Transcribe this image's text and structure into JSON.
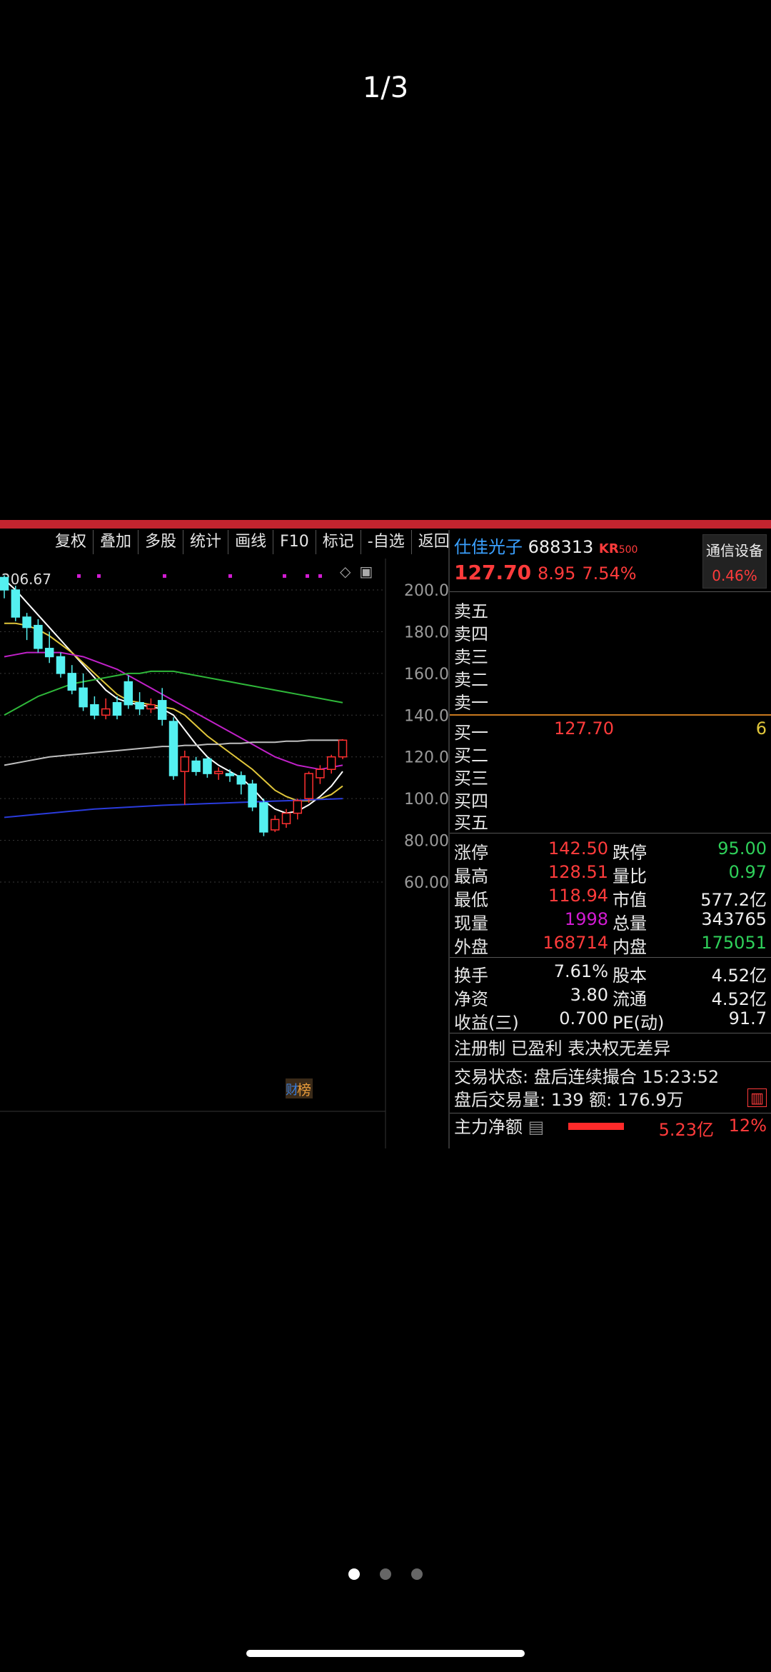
{
  "viewer": {
    "page_indicator": "1/3",
    "dots": 3,
    "active_dot": 0
  },
  "toolbar": {
    "items": [
      "复权",
      "叠加",
      "多股",
      "统计",
      "画线",
      "F10",
      "标记",
      "-自选",
      "返回"
    ]
  },
  "chart": {
    "high_label": "206.67",
    "y_ticks": [
      "200.0",
      "180.0",
      "160.0",
      "140.0",
      "120.0",
      "100.0",
      "80.00",
      "60.00"
    ],
    "badge_text": "榜",
    "badge_prefix": "财"
  },
  "chart_data": {
    "type": "candlestick",
    "ylim": [
      60,
      210
    ],
    "candles": [
      [
        206,
        200,
        207,
        196
      ],
      [
        200,
        187,
        202,
        185
      ],
      [
        187,
        182,
        189,
        176
      ],
      [
        183,
        172,
        186,
        170
      ],
      [
        172,
        168,
        180,
        165
      ],
      [
        168,
        160,
        170,
        158
      ],
      [
        160,
        152,
        164,
        150
      ],
      [
        153,
        144,
        160,
        142
      ],
      [
        145,
        140,
        149,
        138
      ],
      [
        140,
        143,
        148,
        138
      ],
      [
        146,
        140,
        149,
        138
      ],
      [
        156,
        145,
        159,
        143
      ],
      [
        146,
        143,
        151,
        140
      ],
      [
        143,
        145,
        148,
        141
      ],
      [
        147,
        138,
        153,
        135
      ],
      [
        137,
        111,
        139,
        109
      ],
      [
        113,
        120,
        123,
        97
      ],
      [
        118,
        113,
        120,
        111
      ],
      [
        119,
        112,
        120,
        110
      ],
      [
        112,
        113,
        115,
        109
      ],
      [
        112,
        111,
        114,
        108
      ],
      [
        111,
        107,
        113,
        102
      ],
      [
        107,
        96,
        109,
        94
      ],
      [
        98,
        84,
        100,
        82
      ],
      [
        85,
        90,
        92,
        84
      ],
      [
        88,
        93,
        95,
        86
      ],
      [
        93,
        99,
        100,
        90
      ],
      [
        100,
        112,
        113,
        98
      ],
      [
        110,
        114,
        116,
        107
      ],
      [
        114,
        120,
        121,
        112
      ],
      [
        120,
        128,
        128.5,
        118.9
      ]
    ],
    "ma_series": [
      {
        "color": "#ffffff",
        "values": [
          205,
          200,
          194,
          188,
          182,
          176,
          170,
          164,
          158,
          152,
          148,
          146,
          145,
          144,
          143,
          140,
          133,
          126,
          120,
          116,
          113,
          110,
          105,
          99,
          95,
          93,
          94,
          97,
          101,
          106,
          113
        ]
      },
      {
        "color": "#e0c63b",
        "values": [
          184,
          184,
          183,
          181,
          178,
          174,
          170,
          165,
          160,
          155,
          150,
          147,
          146,
          145,
          144,
          143,
          140,
          135,
          130,
          126,
          122,
          118,
          114,
          109,
          104,
          101,
          99,
          99,
          100,
          102,
          106
        ]
      },
      {
        "color": "#c021c8",
        "values": [
          168,
          169,
          170,
          170,
          170,
          170,
          169,
          168,
          166,
          164,
          162,
          159,
          156,
          153,
          150,
          147,
          144,
          141,
          138,
          135,
          132,
          129,
          126,
          123,
          120,
          118,
          116,
          115,
          114,
          115,
          116
        ]
      },
      {
        "color": "#2fb83a",
        "values": [
          140,
          143,
          146,
          149,
          151,
          153,
          155,
          156,
          157,
          158,
          159,
          160,
          160,
          161,
          161,
          161,
          160,
          159,
          158,
          157,
          156,
          155,
          154,
          153,
          152,
          151,
          150,
          149,
          148,
          147,
          146
        ]
      },
      {
        "color": "#bfbfbf",
        "values": [
          116,
          117,
          118,
          119,
          120,
          120.5,
          121,
          121.5,
          122,
          122.5,
          123,
          123.5,
          124,
          124.5,
          125,
          125,
          125.5,
          125.5,
          126,
          126,
          126.5,
          126.5,
          127,
          127,
          127,
          127.5,
          127.5,
          128,
          128,
          128,
          128
        ]
      },
      {
        "color": "#2a3bdc",
        "values": [
          91,
          91.5,
          92,
          92.5,
          93,
          93.5,
          94,
          94.5,
          95,
          95.3,
          95.6,
          95.9,
          96.2,
          96.5,
          96.8,
          97,
          97.2,
          97.4,
          97.6,
          97.8,
          98,
          98.2,
          98.4,
          98.6,
          98.8,
          99,
          99.2,
          99.4,
          99.6,
          99.8,
          100
        ]
      }
    ]
  },
  "stock": {
    "name": "仕佳光子",
    "code": "688313",
    "tag1": "KR",
    "tag2": "500",
    "price": "127.70",
    "change": "8.95",
    "pct": "7.54%",
    "industry": "通信设备",
    "industry_pct": "0.46%"
  },
  "orderbook": {
    "asks": [
      "卖五",
      "卖四",
      "卖三",
      "卖二",
      "卖一"
    ],
    "bids": [
      {
        "label": "买一",
        "price": "127.70",
        "vol": "6"
      },
      {
        "label": "买二",
        "price": "",
        "vol": ""
      },
      {
        "label": "买三",
        "price": "",
        "vol": ""
      },
      {
        "label": "买四",
        "price": "",
        "vol": ""
      },
      {
        "label": "买五",
        "price": "",
        "vol": ""
      }
    ]
  },
  "stats": {
    "limit_up_label": "涨停",
    "limit_up": "142.50",
    "limit_down_label": "跌停",
    "limit_down": "95.00",
    "high_label": "最高",
    "high": "128.51",
    "vol_ratio_label": "量比",
    "vol_ratio": "0.97",
    "low_label": "最低",
    "low": "118.94",
    "mcap_label": "市值",
    "mcap": "577.2亿",
    "cur_vol_label": "现量",
    "cur_vol": "1998",
    "total_vol_label": "总量",
    "total_vol": "343765",
    "outer_label": "外盘",
    "outer": "168714",
    "inner_label": "内盘",
    "inner": "175051",
    "turnover_label": "换手",
    "turnover": "7.61%",
    "shares_label": "股本",
    "shares": "4.52亿",
    "nav_label": "净资",
    "nav": "3.80",
    "float_label": "流通",
    "float": "4.52亿",
    "eps_label": "收益(三)",
    "eps": "0.700",
    "pe_label": "PE(动)",
    "pe": "91.7"
  },
  "info": {
    "line1": "注册制 已盈利 表决权无差异",
    "status": "交易状态: 盘后连续撮合 15:23:52",
    "after_hours": "盘后交易量: 139  额: 176.9万",
    "main_flow_label": "主力净额",
    "main_flow": "5.23亿",
    "main_flow_pct": "12%"
  }
}
